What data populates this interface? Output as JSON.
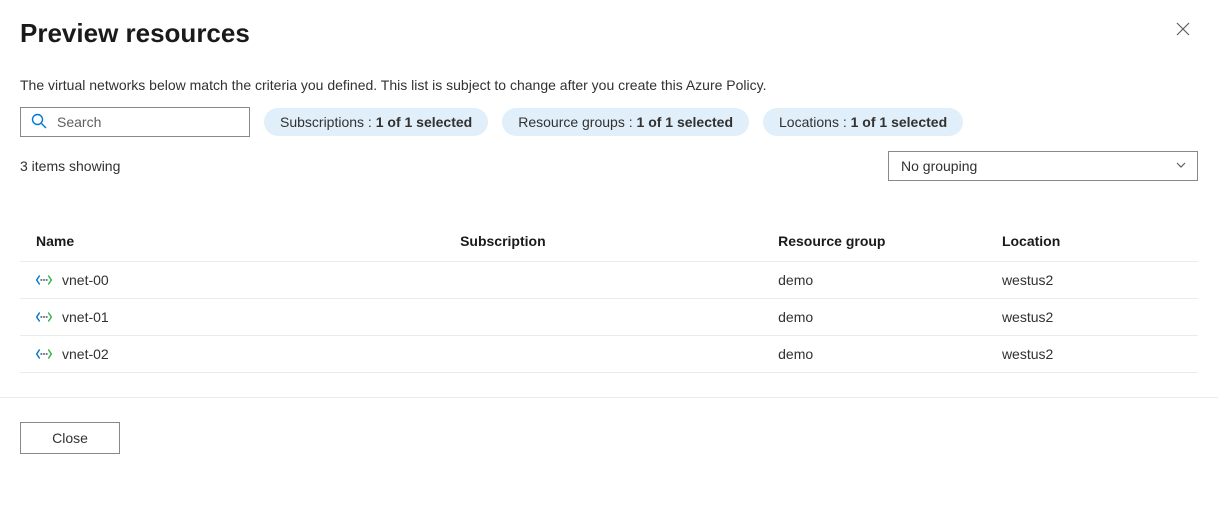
{
  "title": "Preview resources",
  "description": "The virtual networks below match the criteria you defined. This list is subject to change after you create this Azure Policy.",
  "search": {
    "placeholder": "Search"
  },
  "filters": {
    "subscriptions": {
      "label": "Subscriptions : ",
      "value": "1 of 1 selected"
    },
    "resourceGroups": {
      "label": "Resource groups : ",
      "value": "1 of 1 selected"
    },
    "locations": {
      "label": "Locations : ",
      "value": "1 of 1 selected"
    }
  },
  "countText": "3 items showing",
  "grouping": {
    "selected": "No grouping"
  },
  "columns": {
    "name": "Name",
    "subscription": "Subscription",
    "resourceGroup": "Resource group",
    "location": "Location"
  },
  "rows": [
    {
      "name": "vnet-00",
      "subscription": "",
      "resourceGroup": "demo",
      "location": "westus2"
    },
    {
      "name": "vnet-01",
      "subscription": "",
      "resourceGroup": "demo",
      "location": "westus2"
    },
    {
      "name": "vnet-02",
      "subscription": "",
      "resourceGroup": "demo",
      "location": "westus2"
    }
  ],
  "closeLabel": "Close"
}
